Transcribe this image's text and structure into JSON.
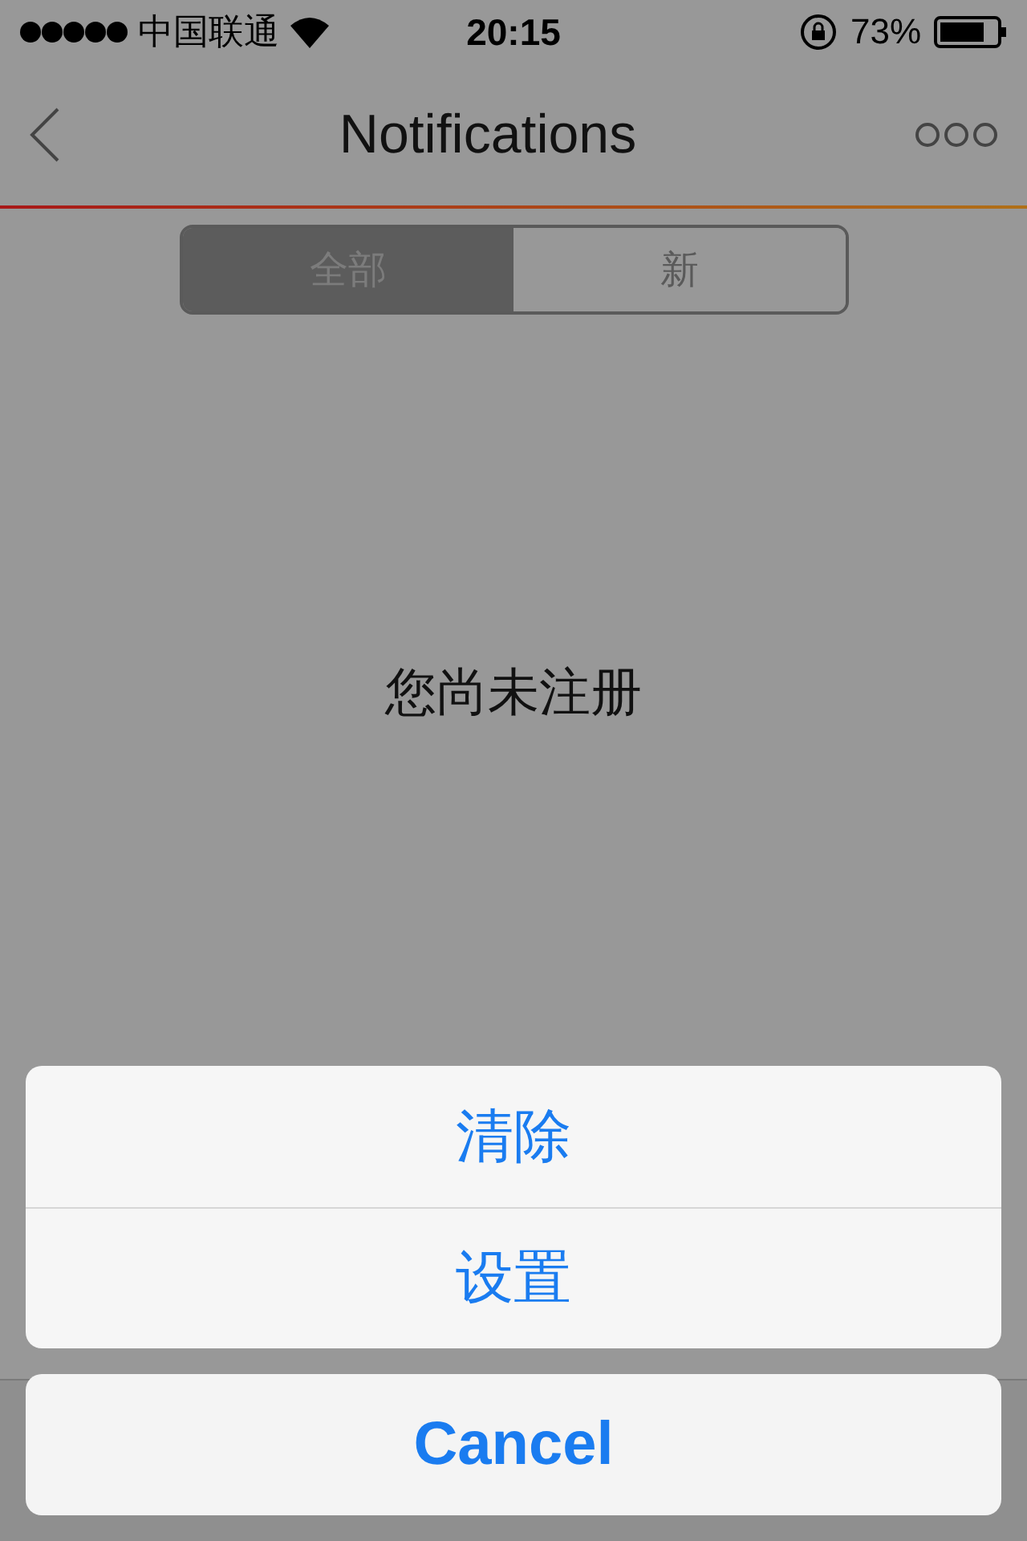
{
  "status_bar": {
    "carrier": "中国联通",
    "time": "20:15",
    "battery": "73%"
  },
  "nav": {
    "title": "Notifications"
  },
  "segments": [
    {
      "label": "全部",
      "selected": true
    },
    {
      "label": "新",
      "selected": false
    }
  ],
  "message": "您尚未注册",
  "action_sheet": {
    "actions": [
      "清除",
      "设置"
    ],
    "cancel": "Cancel"
  }
}
